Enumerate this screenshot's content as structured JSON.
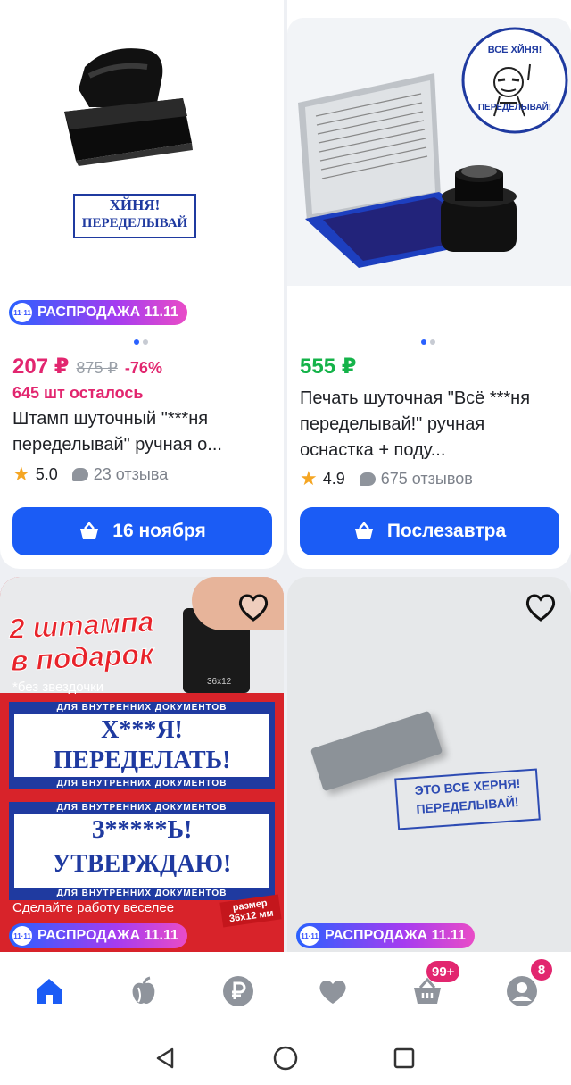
{
  "cards": [
    {
      "promo": "РАСПРОДАЖА 11.11",
      "promo_icon": "11·11",
      "stamp_line1": "ХЙНЯ!",
      "stamp_line2": "ПЕРЕДЕЛЫВАЙ",
      "price": "207 ₽",
      "old_price": "875 ₽",
      "discount": "-76%",
      "stock": "645 шт осталось",
      "title": "Штамп шуточный \"***ня переделывай\" ручная о...",
      "rating": "5.0",
      "reviews": "23 отзыва",
      "button": "16 ноября",
      "image_index": 0,
      "image_count": 2
    },
    {
      "logo_top": "ВСЕ ХЙНЯ!",
      "logo_bottom": "ПЕРЕДЕЛЫВАЙ!",
      "price": "555 ₽",
      "title": "Печать шуточная \"Всё ***ня переделывай!\" ручная оснастка + поду...",
      "rating": "4.9",
      "reviews": "675 отзывов",
      "button": "Послезавтра",
      "image_index": 0,
      "image_count": 2
    },
    {
      "banner_line1": "2 штампа",
      "banner_line2": "в подарок",
      "note": "*без звездочки",
      "small_label": "ДЛЯ ВНУТРЕННИХ ДОКУМЕНТОВ",
      "device_label": "36x12",
      "device_sub": "размер",
      "stamp1_a": "Х***Я!",
      "stamp1_b": "ПЕРЕДЕЛАТЬ!",
      "stamp2_a": "З*****Ь!",
      "stamp2_b": "УТВЕРЖДАЮ!",
      "footer": "Сделайте работу веселее",
      "size_label": "размер 36x12 мм",
      "promo": "РАСПРОДАЖА 11.11",
      "promo_icon": "11·11"
    },
    {
      "imprint_line1": "ЭТО ВСЕ ХЕРНЯ!",
      "imprint_line2": "ПЕРЕДЕЛЫВАЙ!",
      "promo": "РАСПРОДАЖА 11.11",
      "promo_icon": "11·11"
    }
  ],
  "nav": {
    "items": [
      "home-icon",
      "apple-icon",
      "ruble-icon",
      "heart-icon",
      "basket-icon",
      "profile-icon"
    ],
    "cart_count": "99+",
    "profile_count": "8",
    "active_color": "#1b5cf5",
    "inactive_color": "#8f949c"
  },
  "colors": {
    "accent": "#1b5cf5",
    "price_pink": "#e2266f",
    "price_green": "#15b34a"
  }
}
